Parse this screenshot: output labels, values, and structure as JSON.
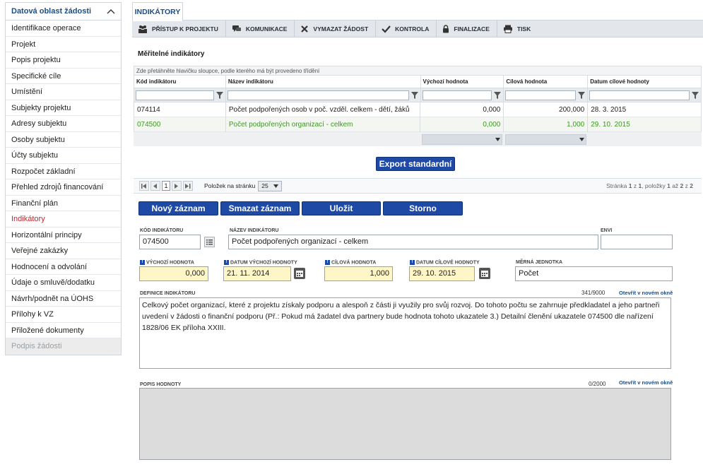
{
  "sidebar": {
    "header": "Datová oblast žádosti",
    "items": [
      "Identifikace operace",
      "Projekt",
      "Popis projektu",
      "Specifické cíle",
      "Umístění",
      "Subjekty projektu",
      "Adresy subjektu",
      "Osoby subjektu",
      "Účty subjektu",
      "Rozpočet základní",
      "Přehled zdrojů financování",
      "Finanční plán",
      "Indikátory",
      "Horizontální principy",
      "Veřejné zakázky",
      "Hodnocení a odvolání",
      "Údaje o smluvě/dodatku",
      "Návrh/podnět na ÚOHS",
      "Přílohy k VZ",
      "Přiložené dokumenty",
      "Podpis žádosti"
    ],
    "active_index": 12,
    "disabled_index": 20
  },
  "tab": "INDIKÁTORY",
  "toolbar": {
    "access": "PŘÍSTUP K PROJEKTU",
    "communication": "KOMUNIKACE",
    "delete": "VYMAZAT ŽÁDOST",
    "check": "KONTROLA",
    "finalize": "FINALIZACE",
    "print": "TISK"
  },
  "section_title": "Měřitelné indikátory",
  "grid": {
    "group_hint": "Zde přetáhněte hlavičku sloupce, podle kterého má být provedeno třídění",
    "headers": [
      "Kód indikátoru",
      "Název indikátoru",
      "Výchozí hodnota",
      "Cílová hodnota",
      "Datum cílové hodnoty"
    ],
    "rows": [
      {
        "code": "074114",
        "name": "Počet podpořených osob v poč. vzděl. celkem - dětí, žáků",
        "start": "0,000",
        "target": "200,000",
        "date": "28. 3. 2015"
      },
      {
        "code": "074500",
        "name": "Počet podpořených organizací - celkem",
        "start": "0,000",
        "target": "1,000",
        "date": "29. 10. 2015"
      }
    ],
    "selected_row": 1
  },
  "export_button": "Export standardní",
  "pager": {
    "page": "1",
    "per_page_label": "Položek na stránku",
    "per_page": "25",
    "summary_prefix": "Stránka ",
    "summary_page": "1",
    "summary_of": " z ",
    "summary_pages": "1",
    "summary_items": ", položky ",
    "summary_from": "1",
    "summary_to_word": " až ",
    "summary_to": "2",
    "summary_total_word": " z ",
    "summary_total": "2"
  },
  "actions": {
    "new": "Nový záznam",
    "delete": "Smazat záznam",
    "save": "Uložit",
    "cancel": "Storno"
  },
  "form": {
    "code_label": "KÓD INDIKÁTORU",
    "code_value": "074500",
    "name_label": "NÁZEV INDIKÁTORU",
    "name_value": "Počet podpořených organizací - celkem",
    "envi_label": "ENVI",
    "envi_value": "",
    "start_label": "VÝCHOZÍ HODNOTA",
    "start_value": "0,000",
    "start_date_label": "DATUM VÝCHOZÍ HODNOTY",
    "start_date_value": "21. 11. 2014",
    "target_label": "CÍLOVÁ HODNOTA",
    "target_value": "1,000",
    "target_date_label": "DATUM CÍLOVÉ HODNOTY",
    "target_date_value": "29. 10. 2015",
    "unit_label": "MĚRNÁ JEDNOTKA",
    "unit_value": "Počet",
    "definition_label": "DEFINICE INDIKÁTORU",
    "definition_counter": "341/9000",
    "definition_link": "Otevřít v novém okně",
    "definition_text": "Celkový počet organizací, které z projektu získaly podporu a alespoň z části ji využily pro svůj rozvoj. Do tohoto počtu se zahrnuje předkladatel a jeho partneři uvedení v žádosti o finanční podporu (Př.: Pokud má žadatel dva partnery bude hodnota tohoto ukazatele 3.) Detailní členění ukazatele 074500 dle nařízení 1828/06 EK příloha XXIII.",
    "description_label": "POPIS HODNOTY",
    "description_counter": "0/2000",
    "description_link": "Otevřít v novém okně",
    "description_text": ""
  },
  "colors": {
    "accent_blue": "#1e4aa6",
    "active_red": "#c0262d",
    "selected_green": "#3b9a1e",
    "required_yellow": "#fff6c8"
  }
}
